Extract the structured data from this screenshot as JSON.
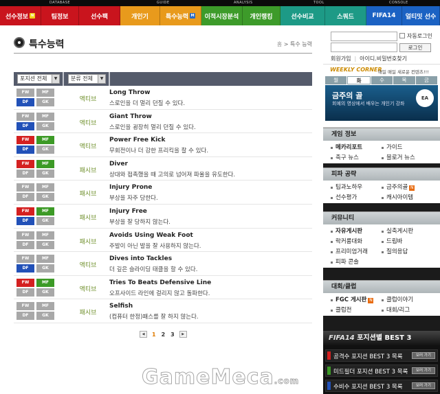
{
  "top_categories": [
    {
      "label": "DATABASE"
    },
    {
      "label": "GUIDE"
    },
    {
      "label": "ANALYSIS"
    },
    {
      "label": "TOOL"
    },
    {
      "label": "CONSOLE"
    }
  ],
  "nav": [
    {
      "label": "선수정보",
      "color": "#c9141d",
      "badge": "N",
      "badge_color": "#f3d21a",
      "width": 60
    },
    {
      "label": "팀정보",
      "color": "#c9141d",
      "width": 55
    },
    {
      "label": "선수팩",
      "color": "#c9141d",
      "width": 60
    },
    {
      "label": "개인기",
      "color": "#e89a1c",
      "width": 58
    },
    {
      "label": "특수능력",
      "color": "#e89a1c",
      "badge": "M",
      "badge_color": "#2a6cc4",
      "width": 60
    },
    {
      "label": "이적시장분석",
      "color": "#3d9b2a",
      "width": 60
    },
    {
      "label": "개인랭킹",
      "color": "#3d9b2a",
      "width": 55
    },
    {
      "label": "선수비교",
      "color": "#1d9a86",
      "width": 65
    },
    {
      "label": "스쿼드",
      "color": "#1d9a86",
      "width": 60
    },
    {
      "label": "FIFA14",
      "color": "#1b62c3",
      "width": 52
    },
    {
      "label": "얼티밋 선수",
      "color": "#1b62c3",
      "width": 55
    }
  ],
  "page": {
    "title": "특수능력",
    "breadcrumb_home": "홈",
    "breadcrumb_sep": ">",
    "breadcrumb_current": "특수 능력"
  },
  "filters": {
    "position": "포지션 전체",
    "category": "분류 전체"
  },
  "position_labels": {
    "fw": "FW",
    "mf": "MF",
    "df": "DF",
    "gk": "GK"
  },
  "position_colors": {
    "fw": "#d42020",
    "mf": "#3c9a26",
    "df": "#2251b8",
    "gk": "#8a8a8a",
    "off": "#a8a8a8"
  },
  "abilities": [
    {
      "name": "Long Throw",
      "desc": "스로인을 더 멀리 던질 수 있다.",
      "type": "액티브",
      "fw": false,
      "mf": false,
      "df": true,
      "gk": false
    },
    {
      "name": "Giant Throw",
      "desc": "스로인을 굉장히 멀리 던질 수 있다.",
      "type": "액티브",
      "fw": false,
      "mf": false,
      "df": true,
      "gk": false
    },
    {
      "name": "Power Free Kick",
      "desc": "무회전이나 더 강한 프리킥을 찰 수 있다.",
      "type": "액티브",
      "fw": true,
      "mf": true,
      "df": true,
      "gk": false
    },
    {
      "name": "Diver",
      "desc": "상대와 접촉했을 때 고의로 넘어져 파울을 유도한다.",
      "type": "패시브",
      "fw": true,
      "mf": true,
      "df": false,
      "gk": false
    },
    {
      "name": "Injury Prone",
      "desc": "부상을 자주 당한다.",
      "type": "패시브",
      "fw": false,
      "mf": false,
      "df": false,
      "gk": false
    },
    {
      "name": "Injury Free",
      "desc": "부상을 잘 당하지 않는다.",
      "type": "패시브",
      "fw": true,
      "mf": true,
      "df": true,
      "gk": false
    },
    {
      "name": "Avoids Using Weak Foot",
      "desc": "주발이 아닌 발을 잘 사용하지 않는다.",
      "type": "패시브",
      "fw": false,
      "mf": false,
      "df": false,
      "gk": false
    },
    {
      "name": "Dives into Tackles",
      "desc": "더 깊은 슬라이딩 태클을 할 수 있다.",
      "type": "액티브",
      "fw": false,
      "mf": false,
      "df": true,
      "gk": false
    },
    {
      "name": "Tries To Beats Defensive Line",
      "desc": "오프사이드 라인에 걸리지 않고 돌파한다.",
      "type": "액티브",
      "fw": true,
      "mf": true,
      "df": false,
      "gk": false
    },
    {
      "name": "Selfish",
      "desc": "(컴퓨터 한정)패스를 잘 하지 않는다.",
      "type": "패시브",
      "fw": false,
      "mf": false,
      "df": false,
      "gk": false
    }
  ],
  "pagination": {
    "prev": "◀",
    "next": "▶",
    "pages": [
      "1",
      "2",
      "3"
    ],
    "current": "1"
  },
  "login": {
    "remember_label": "자동로그인",
    "login_button": "로그인",
    "signup": "회원가입",
    "find": "아이디.비밀번호찾기"
  },
  "weekly": {
    "heading": "WEEKLY CORNER",
    "subheading": "매일 매일 새로운 컨텐츠!!!",
    "tabs": [
      "월",
      "화",
      "수",
      "목",
      "금"
    ],
    "active_tab": "화",
    "banner_title": "금주의 골",
    "banner_desc": "회예의 영상에서 배우는 개인기 강좌",
    "banner_logo": "EA"
  },
  "side_boxes": [
    {
      "title": "게임 정보",
      "items": [
        {
          "label": "메카리포트",
          "bold": true
        },
        {
          "label": "가이드"
        },
        {
          "label": "축구 뉴스"
        },
        {
          "label": "블로거 뉴스"
        }
      ]
    },
    {
      "title": "피파 공략",
      "items": [
        {
          "label": "팁과노하우"
        },
        {
          "label": "금주의골",
          "new": "N"
        },
        {
          "label": "선수평가"
        },
        {
          "label": "캐시아이템"
        }
      ]
    },
    {
      "title": "커뮤니티",
      "items": [
        {
          "label": "자유게시판",
          "bold": true
        },
        {
          "label": "실축게시판"
        },
        {
          "label": "락커룸대화"
        },
        {
          "label": "드립바"
        },
        {
          "label": "프리미엄거래"
        },
        {
          "label": "질의응답"
        },
        {
          "label": "피파 콘솔"
        }
      ]
    },
    {
      "title": "대회/클럽",
      "items": [
        {
          "label": "FGC 게시판",
          "bold": true,
          "new": "N"
        },
        {
          "label": "클럽이야기"
        },
        {
          "label": "클럽전"
        },
        {
          "label": "대회/리그"
        }
      ]
    }
  ],
  "best3": {
    "brand": "FIFA14",
    "title": "포지션별 BEST 3",
    "rows": [
      {
        "label": "공격수 포지션 BEST 3 목록",
        "color": "#d42020",
        "button": "보러 가기"
      },
      {
        "label": "미드필더 포지션 BEST 3 목록",
        "color": "#3c9a26",
        "button": "보러 가기"
      },
      {
        "label": "수비수 포지션 BEST 3 목록",
        "color": "#2251b8",
        "button": "보러 가기"
      }
    ]
  },
  "watermark": {
    "brand": "GameMeca",
    "domain": ".com"
  }
}
